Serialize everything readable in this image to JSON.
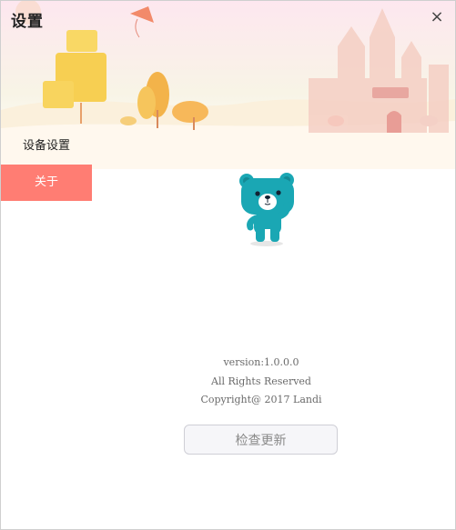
{
  "window": {
    "title": "设置",
    "close_icon": "×"
  },
  "sidebar": {
    "items": [
      {
        "label": "设备设置",
        "active": false
      },
      {
        "label": "关于",
        "active": true
      }
    ]
  },
  "about": {
    "mascot": "teal-bear-icon",
    "version": "version:1.0.0.0",
    "rights": "All Rights Reserved",
    "copyright": "Copyright@ 2017 Landi",
    "check_update_label": "检查更新"
  },
  "colors": {
    "active_tab": "#ff7d73",
    "bear": "#1aa7b4",
    "banner_top": "#fde7ef",
    "banner_bottom": "#fffaf1"
  }
}
